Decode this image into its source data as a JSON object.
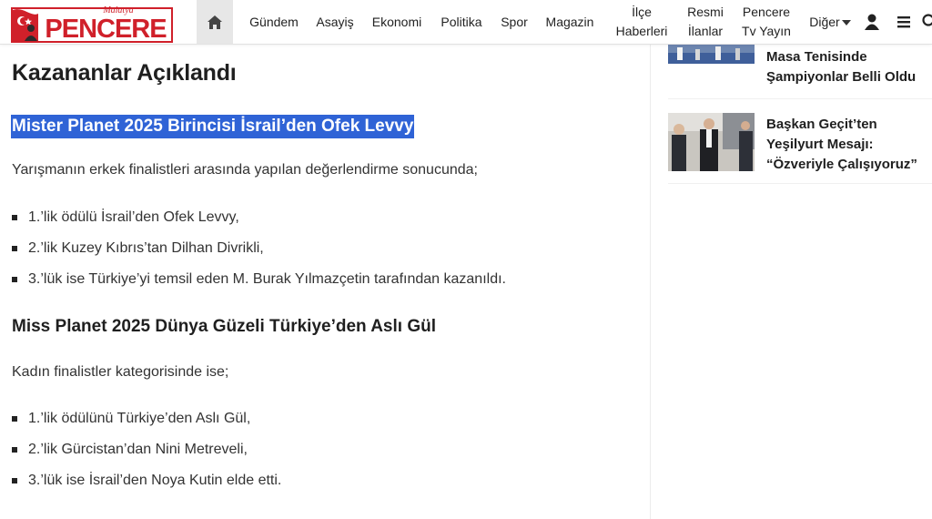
{
  "header": {
    "logo_top": "Malatya",
    "logo_main": "PENCERE",
    "nav": [
      {
        "label": "Gündem"
      },
      {
        "label": "Asayiş"
      },
      {
        "label": "Ekonomi"
      },
      {
        "label": "Politika"
      },
      {
        "label": "Spor"
      },
      {
        "label": "Magazin"
      },
      {
        "line1": "İlçe",
        "line2": "Haberleri"
      },
      {
        "line1": "Resmi",
        "line2": "İlanlar"
      },
      {
        "line1": "Pencere",
        "line2": "Tv Yayın"
      },
      {
        "label": "Diğer"
      }
    ]
  },
  "article": {
    "heading": "Kazananlar Açıklandı",
    "section1_title": "Mister Planet 2025 Birincisi İsrail’den Ofek Levvy",
    "section1_intro": "Yarışmanın erkek finalistleri arasında yapılan değerlendirme sonucunda;",
    "section1_items": [
      "1.’lik ödülü İsrail’den Ofek Levvy,",
      "2.’lik Kuzey Kıbrıs’tan Dilhan Divrikli,",
      "3.’lük ise Türkiye’yi temsil eden M. Burak Yılmazçetin tarafından kazanıldı."
    ],
    "section2_title": "Miss Planet 2025 Dünya Güzeli Türkiye’den Aslı Gül",
    "section2_intro": "Kadın finalistler kategorisinde ise;",
    "section2_items": [
      "1.’lik ödülünü Türkiye’den Aslı Gül,",
      "2.’lik Gürcistan’dan Nini Metreveli,",
      "3.’lük ise İsrail’den Noya Kutin elde etti."
    ]
  },
  "sidebar": {
    "items": [
      {
        "line1": "Masa Tenisinde",
        "line2": "Şampiyonlar Belli Oldu"
      },
      {
        "line1": "Başkan Geçit’ten",
        "line2": "Yeşilyurt Mesajı:",
        "line3": "“Özveriyle Çalışıyoruz”"
      }
    ]
  },
  "colors": {
    "brand_red": "#d0202a",
    "highlight": "#2f63d6"
  },
  "icons": [
    "home-icon",
    "caret-down-icon",
    "user-icon",
    "menu-icon",
    "search-icon"
  ]
}
